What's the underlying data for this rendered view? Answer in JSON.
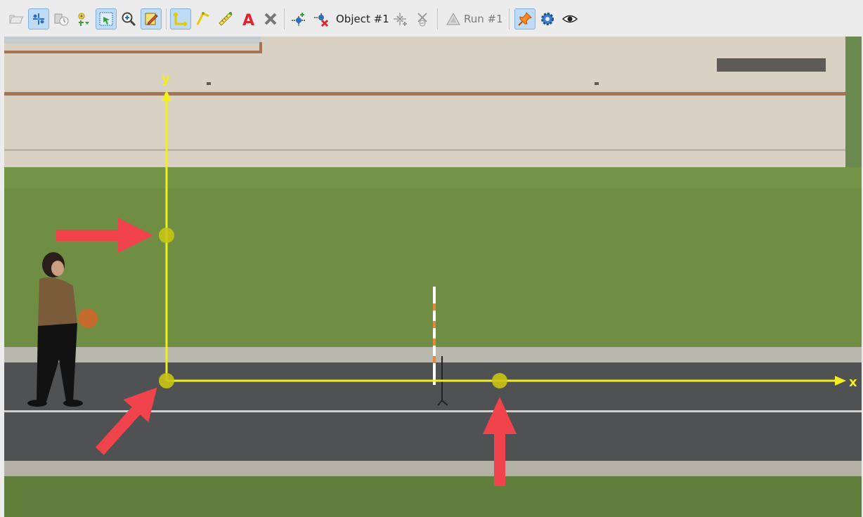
{
  "toolbar": {
    "tools": [
      {
        "name": "open-video-icon",
        "active": false
      },
      {
        "name": "calibration-points-icon",
        "active": true
      },
      {
        "name": "clip-settings-icon",
        "active": false
      },
      {
        "name": "autotracker-icon",
        "active": false
      },
      {
        "name": "select-region-icon",
        "active": true
      },
      {
        "name": "zoom-icon",
        "active": false
      },
      {
        "name": "drawing-tool-icon",
        "active": true
      },
      {
        "name": "axes-icon",
        "active": true
      },
      {
        "name": "protractor-icon",
        "active": false
      },
      {
        "name": "tape-measure-icon",
        "active": false
      },
      {
        "name": "text-tool-icon",
        "active": false
      },
      {
        "name": "delete-icon",
        "active": false
      },
      {
        "name": "add-point-icon",
        "active": false
      },
      {
        "name": "remove-point-icon",
        "active": false
      },
      {
        "name": "add-object-icon",
        "active": false
      },
      {
        "name": "delete-object-icon",
        "active": false
      },
      {
        "name": "run-icon",
        "active": false
      },
      {
        "name": "pin-icon",
        "active": true
      },
      {
        "name": "settings-gear-icon",
        "active": false
      },
      {
        "name": "visibility-eye-icon",
        "active": false
      }
    ],
    "object_label": "Object #1",
    "run_label": "Run #1"
  },
  "viewer": {
    "x_axis_label": "x",
    "y_axis_label": "y",
    "accent_color": "#f2ee1f",
    "arrow_color": "#f1434b"
  }
}
